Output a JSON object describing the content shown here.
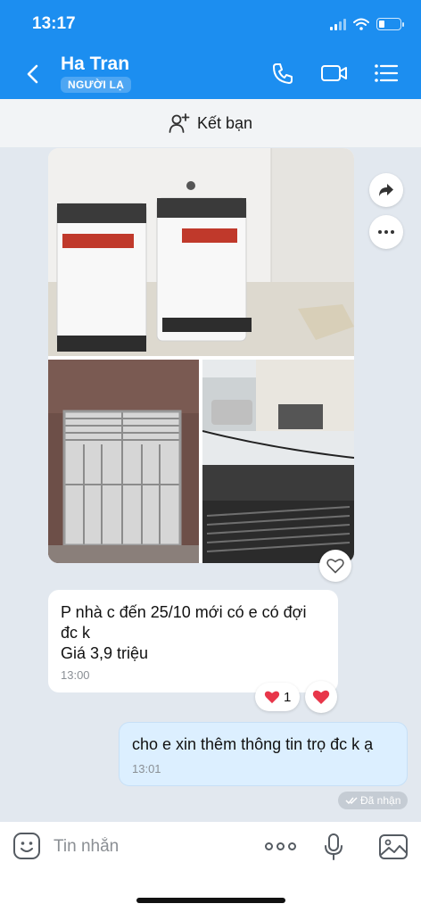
{
  "status_bar": {
    "time": "13:17"
  },
  "header": {
    "contact_name": "Ha Tran",
    "badge": "NGƯỜI LẠ",
    "icons": [
      "back-icon",
      "phone-icon",
      "video-icon",
      "menu-list-icon"
    ]
  },
  "friend_bar": {
    "label": "Kết bạn",
    "icon": "add-friend-icon"
  },
  "messages": [
    {
      "direction": "incoming",
      "type": "images",
      "count": 3
    },
    {
      "direction": "incoming",
      "type": "text",
      "text": "P nhà c đến 25/10 mới có e có đợi\nđc k\nGiá 3,9 triệu",
      "time": "13:00",
      "reaction_count": "1"
    },
    {
      "direction": "outgoing",
      "type": "text",
      "text": "cho e xin thêm thông tin trọ đc k ạ",
      "time": "13:01",
      "status": "Đã nhận"
    }
  ],
  "composer": {
    "placeholder": "Tin nhắn"
  },
  "colors": {
    "header": "#1c8ef0",
    "outgoing_bubble": "#dcefff",
    "heart": "#e8364a"
  }
}
